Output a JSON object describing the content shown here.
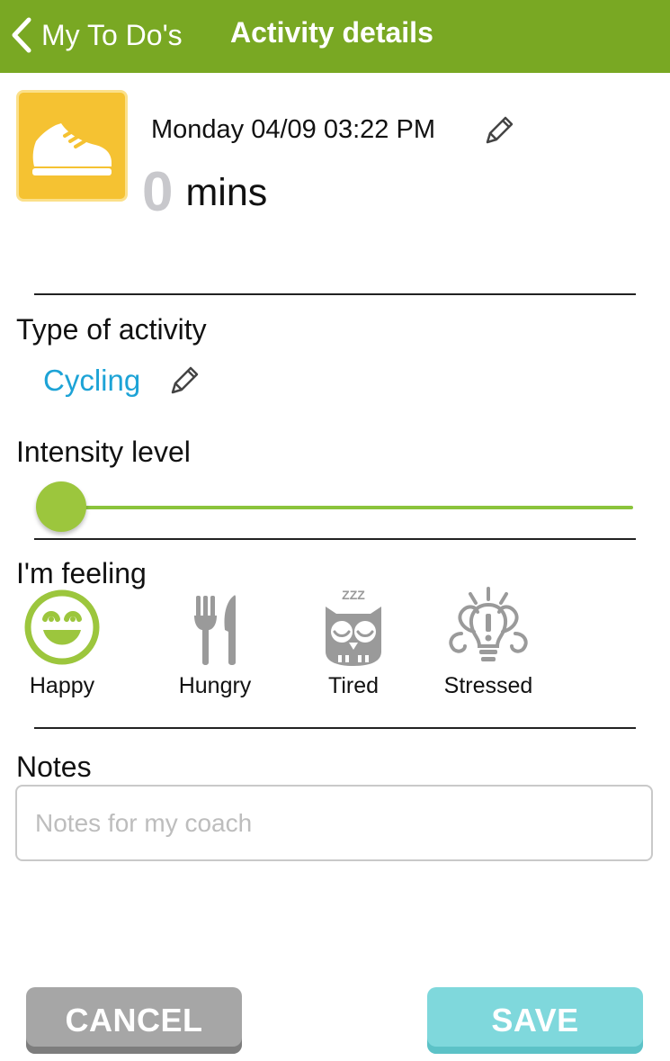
{
  "header": {
    "back_label": "My To Do's",
    "title": "Activity details"
  },
  "activity": {
    "icon": "running-shoe-icon",
    "datetime": "Monday 04/09 03:22 PM",
    "duration_value": "0",
    "duration_unit": "mins"
  },
  "type_section": {
    "label": "Type of activity",
    "value": "Cycling"
  },
  "intensity_section": {
    "label": "Intensity level",
    "level": 0
  },
  "feeling_section": {
    "label": "I'm feeling",
    "options": [
      {
        "label": "Happy",
        "icon": "happy-face-icon",
        "selected": true
      },
      {
        "label": "Hungry",
        "icon": "fork-knife-icon",
        "selected": false
      },
      {
        "label": "Tired",
        "icon": "sleepy-owl-icon",
        "selected": false
      },
      {
        "label": "Stressed",
        "icon": "stressed-bulb-icon",
        "selected": false
      }
    ]
  },
  "notes_section": {
    "label": "Notes",
    "placeholder": "Notes for my coach",
    "value": ""
  },
  "buttons": {
    "cancel": "CANCEL",
    "save": "SAVE"
  },
  "colors": {
    "header": "#79a823",
    "activity_icon_bg": "#f5c232",
    "link": "#1da3d6",
    "slider": "#9cc63d",
    "happy_selected": "#9cc63d",
    "inactive_icon": "#9a9a9a",
    "cancel_button": "#a6a6a6",
    "save_button": "#7fd8dc"
  }
}
